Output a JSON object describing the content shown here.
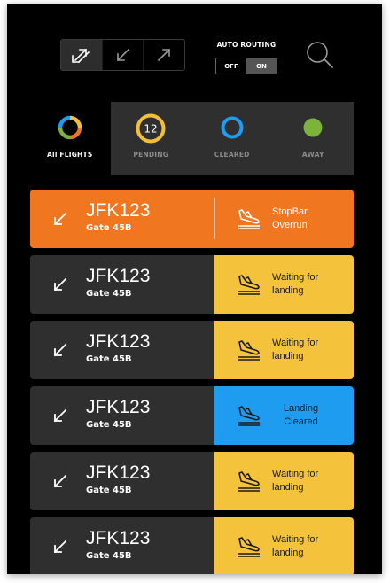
{
  "header": {
    "auto_routing_label": "AUTO ROUTING",
    "toggle_off": "OFF",
    "toggle_on": "ON",
    "active_direction": "both",
    "icons": [
      "bidirectional-arrow-icon",
      "arrival-arrow-icon",
      "departure-arrow-icon",
      "search-icon"
    ]
  },
  "filters": [
    {
      "label": "All FLIGHTS",
      "icon": "multicolor-ring-icon",
      "active": true
    },
    {
      "label": "PENDING",
      "count": "12",
      "icon": "yellow-ring-icon",
      "color": "#f2c037"
    },
    {
      "label": "CLEARED",
      "icon": "blue-ring-icon",
      "color": "#1e9cf0"
    },
    {
      "label": "AWAY",
      "icon": "green-dot-icon",
      "color": "#7cb33a"
    }
  ],
  "colors": {
    "orange": "#f07620",
    "yellow": "#f5c33b",
    "blue": "#1e9cf0",
    "card_dark": "#2f2f2f"
  },
  "flights": [
    {
      "id": "JFK123",
      "gate": "Gate 45B",
      "status_line1": "StopBar",
      "status_line2": "Overrun",
      "kind": "alert"
    },
    {
      "id": "JFK123",
      "gate": "Gate 45B",
      "status_line1": "Waiting for",
      "status_line2": "landing",
      "kind": "waiting"
    },
    {
      "id": "JFK123",
      "gate": "Gate 45B",
      "status_line1": "Waiting for",
      "status_line2": "landing",
      "kind": "waiting"
    },
    {
      "id": "JFK123",
      "gate": "Gate 45B",
      "status_line1": "Landing",
      "status_line2": "Cleared",
      "kind": "cleared"
    },
    {
      "id": "JFK123",
      "gate": "Gate 45B",
      "status_line1": "Waiting for",
      "status_line2": "landing",
      "kind": "waiting"
    },
    {
      "id": "JFK123",
      "gate": "Gate 45B",
      "status_line1": "Waiting for",
      "status_line2": "landing",
      "kind": "waiting"
    }
  ]
}
